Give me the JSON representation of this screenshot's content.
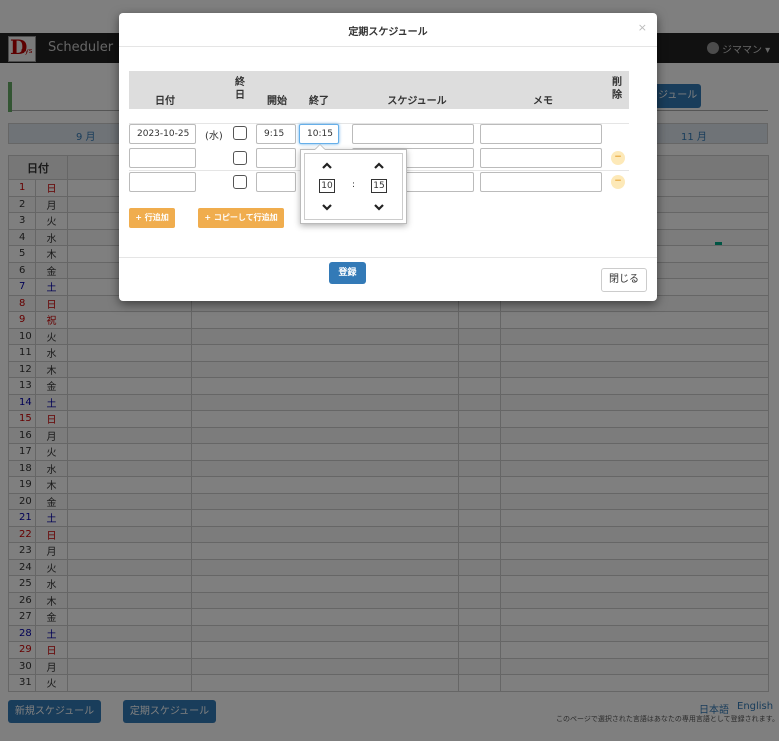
{
  "app": {
    "brand": "Scheduler",
    "logo_text": "D",
    "user": "ジママン ▾",
    "top_button": "ジュール"
  },
  "month_nav": {
    "prev": "9 月",
    "next": "11 月"
  },
  "calendar": {
    "header": "日付",
    "days": [
      {
        "d": "1",
        "w": "日",
        "c": "red"
      },
      {
        "d": "2",
        "w": "月",
        "c": ""
      },
      {
        "d": "3",
        "w": "火",
        "c": ""
      },
      {
        "d": "4",
        "w": "水",
        "c": ""
      },
      {
        "d": "5",
        "w": "木",
        "c": ""
      },
      {
        "d": "6",
        "w": "金",
        "c": ""
      },
      {
        "d": "7",
        "w": "土",
        "c": "blue"
      },
      {
        "d": "8",
        "w": "日",
        "c": "red"
      },
      {
        "d": "9",
        "w": "祝",
        "c": "red"
      },
      {
        "d": "10",
        "w": "火",
        "c": ""
      },
      {
        "d": "11",
        "w": "水",
        "c": ""
      },
      {
        "d": "12",
        "w": "木",
        "c": ""
      },
      {
        "d": "13",
        "w": "金",
        "c": ""
      },
      {
        "d": "14",
        "w": "土",
        "c": "blue"
      },
      {
        "d": "15",
        "w": "日",
        "c": "red"
      },
      {
        "d": "16",
        "w": "月",
        "c": ""
      },
      {
        "d": "17",
        "w": "火",
        "c": ""
      },
      {
        "d": "18",
        "w": "水",
        "c": ""
      },
      {
        "d": "19",
        "w": "木",
        "c": ""
      },
      {
        "d": "20",
        "w": "金",
        "c": ""
      },
      {
        "d": "21",
        "w": "土",
        "c": "blue"
      },
      {
        "d": "22",
        "w": "日",
        "c": "red"
      },
      {
        "d": "23",
        "w": "月",
        "c": ""
      },
      {
        "d": "24",
        "w": "火",
        "c": ""
      },
      {
        "d": "25",
        "w": "水",
        "c": ""
      },
      {
        "d": "26",
        "w": "木",
        "c": ""
      },
      {
        "d": "27",
        "w": "金",
        "c": ""
      },
      {
        "d": "28",
        "w": "土",
        "c": "blue"
      },
      {
        "d": "29",
        "w": "日",
        "c": "red"
      },
      {
        "d": "30",
        "w": "月",
        "c": ""
      },
      {
        "d": "31",
        "w": "火",
        "c": ""
      }
    ]
  },
  "footer": {
    "new_schedule": "新規スケジュール",
    "regular_schedule": "定期スケジュール",
    "lang_ja": "日本語",
    "lang_en": "English",
    "note": "このページで選択された言語はあなたの専用言語として登録されます。"
  },
  "modal": {
    "title": "定期スケジュール",
    "close_x": "×",
    "headers": {
      "date": "日付",
      "allday": "終\n日",
      "start": "開始",
      "end": "終了",
      "schedule": "スケジュール",
      "memo": "メモ",
      "delete": "削\n除"
    },
    "row1": {
      "date": "2023-10-25",
      "weekday": "(水)",
      "start": "9:15",
      "end": "10:15"
    },
    "add_row": "+ 行追加",
    "copy_add_row": "+ コピーして行追加",
    "register": "登録",
    "close": "閉じる",
    "minus": "−"
  },
  "time_picker": {
    "hour": "10",
    "minute": "15",
    "separator": ":"
  }
}
